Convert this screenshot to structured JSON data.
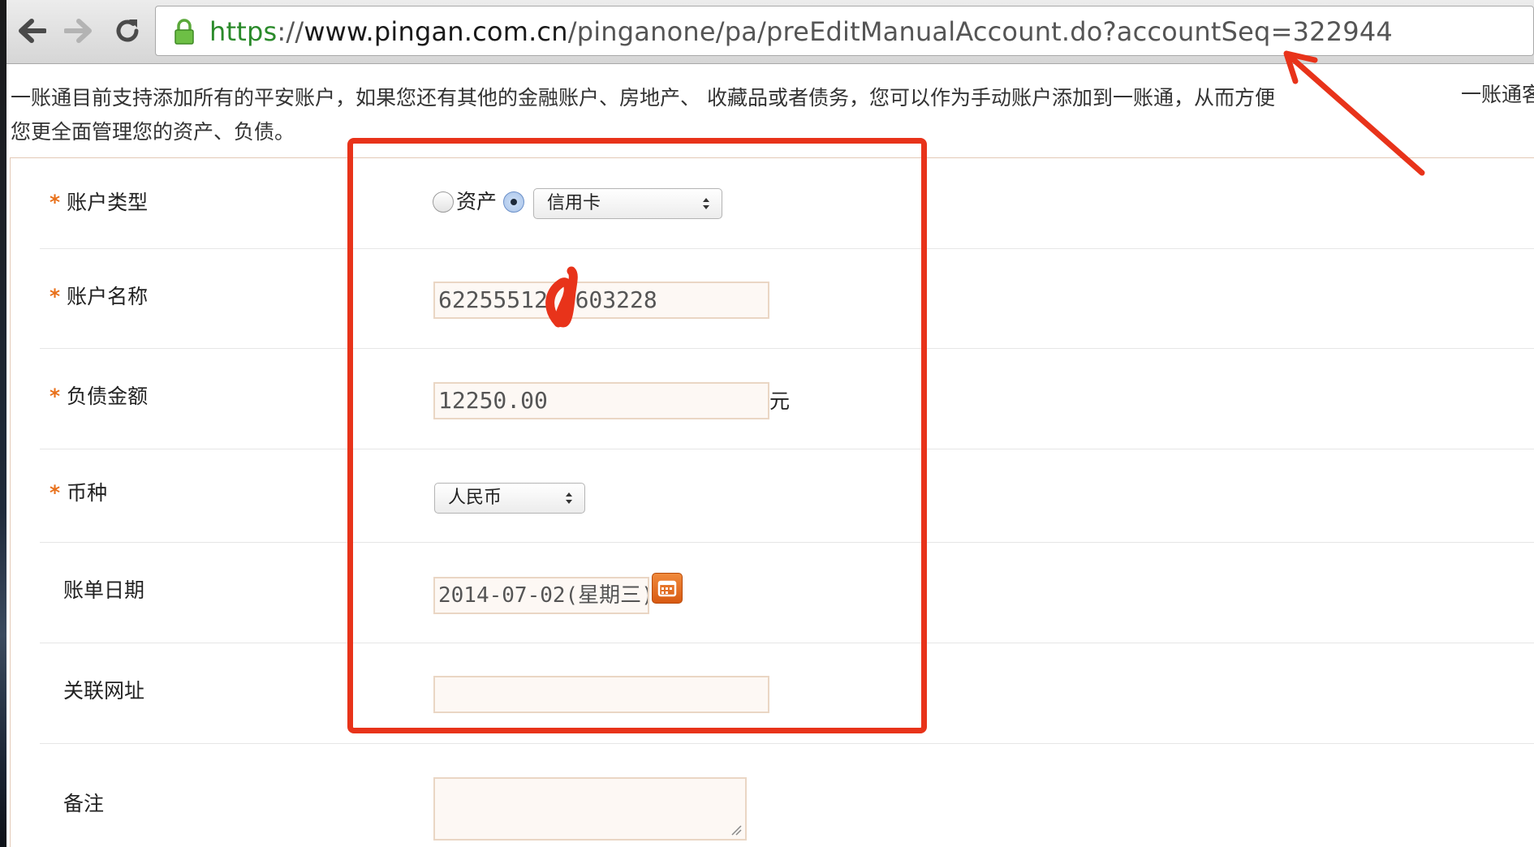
{
  "browser": {
    "url_scheme": "https",
    "url_sep": "://",
    "url_host": "www.pingan.com.cn",
    "url_path": "/pinganone/pa/preEditManualAccount.do?accountSeq=322944",
    "icons": [
      "back-arrow-icon",
      "forward-arrow-icon",
      "reload-icon",
      "lock-icon"
    ]
  },
  "intro": {
    "text": "一账通目前支持添加所有的平安账户，如果您还有其他的金融账户、房地产、 收藏品或者债务，您可以作为手动账户添加到一账通，从而方便您更全面管理您的资产、负债。",
    "right_fragment": "一账通客"
  },
  "form": {
    "required_mark": "*",
    "account_type": {
      "label": "账户类型",
      "option_asset": "资产",
      "option_liability_selected": true,
      "select_value": "信用卡"
    },
    "account_name": {
      "label": "账户名称",
      "value": "62255512 0603228"
    },
    "liability_amount": {
      "label": "负债金额",
      "value": "12250.00",
      "unit": "元"
    },
    "currency": {
      "label": "币种",
      "select_value": "人民币"
    },
    "bill_date": {
      "label": "账单日期",
      "value": "2014-07-02(星期三)",
      "icon": "calendar-icon"
    },
    "related_url": {
      "label": "关联网址",
      "value": ""
    },
    "remark": {
      "label": "备注",
      "value": ""
    }
  },
  "annotation": {
    "color": "#e8331a"
  }
}
